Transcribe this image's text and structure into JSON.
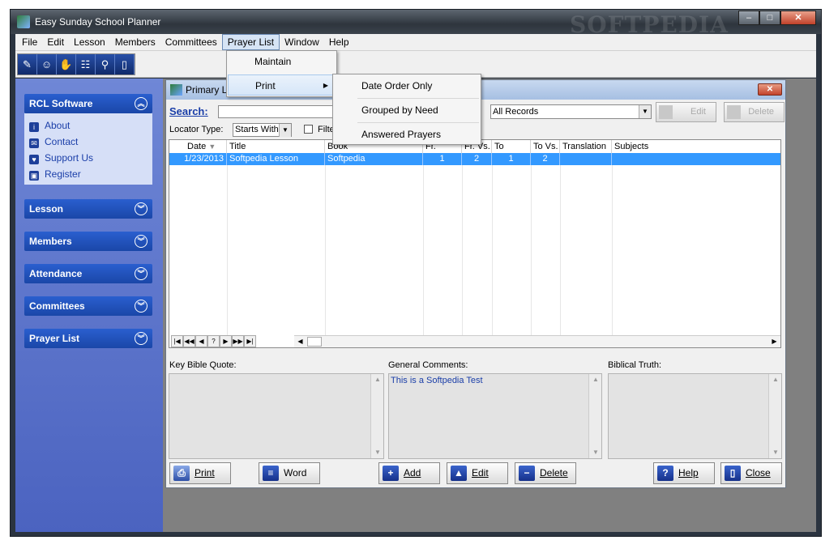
{
  "window": {
    "title": "Easy Sunday School Planner",
    "min": "–",
    "max": "□",
    "close": "✕"
  },
  "watermark": "SOFTPEDIA",
  "menubar": [
    "File",
    "Edit",
    "Lesson",
    "Members",
    "Committees",
    "Prayer List",
    "Window",
    "Help"
  ],
  "toolbar_icons": [
    "lesson-icon",
    "member-icon",
    "prayer-icon",
    "attendance-icon",
    "search-people-icon",
    "exit-door-icon"
  ],
  "sidebar": {
    "rcl": {
      "title": "RCL Software",
      "links": [
        "About",
        "Contact",
        "Support Us",
        "Register"
      ]
    },
    "panels": [
      "Lesson",
      "Members",
      "Attendance",
      "Committees",
      "Prayer List"
    ]
  },
  "child": {
    "title": "Primary L",
    "search_label": "Search:",
    "filter_value": "All Records",
    "edit": "Edit",
    "delete": "Delete",
    "locator_label": "Locator Type:",
    "locator_value": "Starts With",
    "filter_check": "Filte",
    "columns": [
      "Date",
      "Title",
      "Book",
      "Fr. Chap.",
      "Fr. Vs.",
      "To Chap.",
      "To Vs.",
      "Translation",
      "Subjects"
    ],
    "row": {
      "date": "1/23/2013",
      "title": "Softpedia Lesson",
      "book": "Softpedia",
      "fr_chap": "1",
      "fr_vs": "2",
      "to_chap": "1",
      "to_vs": "2",
      "translation": "",
      "subjects": ""
    },
    "nav": [
      "|◀",
      "◀◀",
      "◀",
      "?",
      "▶",
      "▶▶",
      "▶|"
    ],
    "memo_labels": {
      "quote": "Key Bible Quote:",
      "comments": "General Comments:",
      "truth": "Biblical Truth:"
    },
    "comments_text": "This is a Softpedia Test",
    "buttons": {
      "print": "Print",
      "word": "Word",
      "add": "Add",
      "edit": "Edit",
      "delete": "Delete",
      "help": "Help",
      "close": "Close"
    }
  },
  "prayer_menu": {
    "maintain": "Maintain",
    "print": "Print"
  },
  "print_submenu": [
    "Date Order Only",
    "Grouped by Need",
    "Answered Prayers"
  ]
}
